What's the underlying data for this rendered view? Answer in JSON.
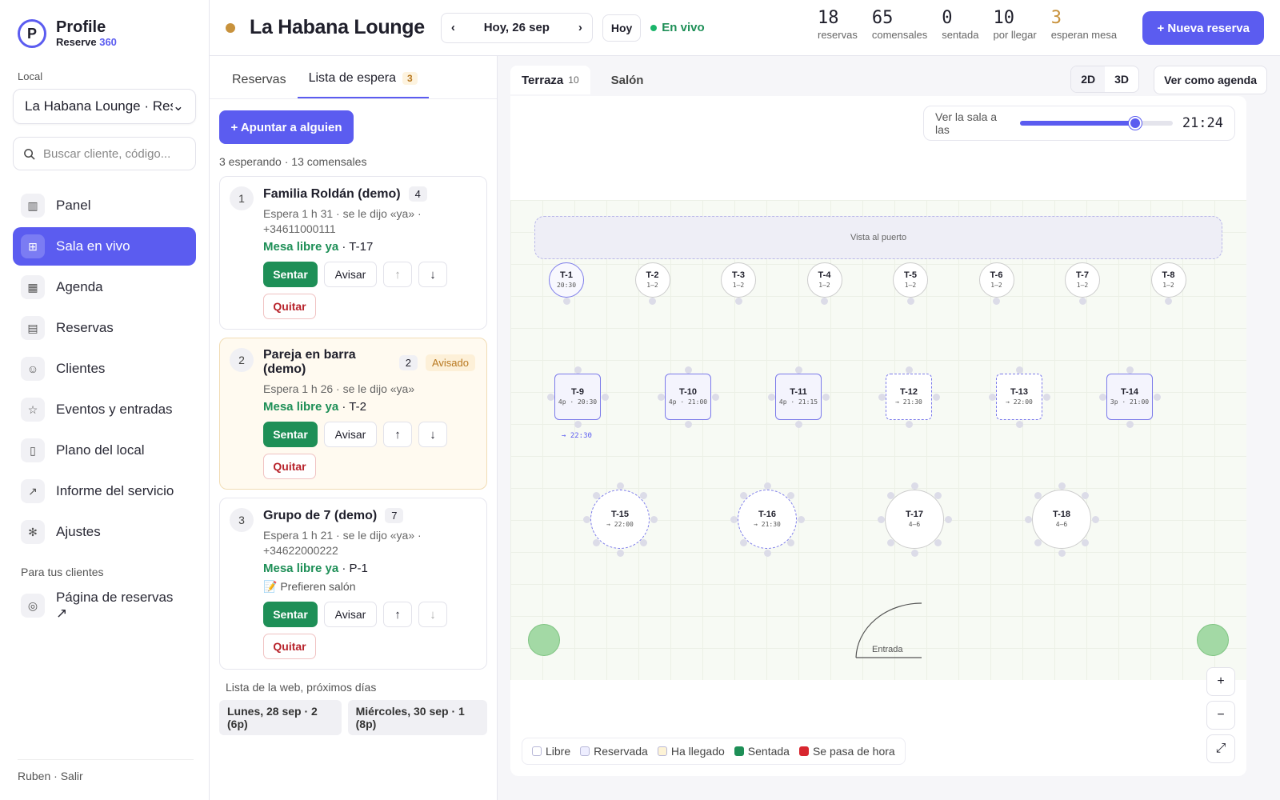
{
  "brand": {
    "title": "Profile",
    "sub_pre": "Reserve ",
    "sub_acc": "360"
  },
  "sidebar": {
    "local_label": "Local",
    "local_value": "La Habana Lounge · Res",
    "search_placeholder": "Buscar cliente, código...",
    "items": [
      {
        "label": "Panel",
        "icon": "chart"
      },
      {
        "label": "Sala en vivo",
        "icon": "grid"
      },
      {
        "label": "Agenda",
        "icon": "table"
      },
      {
        "label": "Reservas",
        "icon": "calendar"
      },
      {
        "label": "Clientes",
        "icon": "users"
      },
      {
        "label": "Eventos y entradas",
        "icon": "star"
      },
      {
        "label": "Plano del local",
        "icon": "map"
      },
      {
        "label": "Informe del servicio",
        "icon": "trend"
      },
      {
        "label": "Ajustes",
        "icon": "gear"
      }
    ],
    "section": "Para tus clientes",
    "public_page": "Página de reservas ↗",
    "footer": "Ruben · Salir"
  },
  "topbar": {
    "venue": "La Habana Lounge",
    "date": "Hoy, 26 sep",
    "today": "Hoy",
    "live": "En vivo",
    "stats": [
      {
        "n": "18",
        "l": "reservas"
      },
      {
        "n": "65",
        "l": "comensales"
      },
      {
        "n": "0",
        "l": "sentada"
      },
      {
        "n": "10",
        "l": "por llegar"
      },
      {
        "n": "3",
        "l": "esperan mesa"
      }
    ],
    "new_button": "+ Nueva reserva"
  },
  "waitlist": {
    "tab_reservas": "Reservas",
    "tab_lista": "Lista de espera",
    "tab_badge": "3",
    "add_button": "+ Apuntar a alguien",
    "summary": "3 esperando · 13 comensales",
    "cards": [
      {
        "num": "1",
        "name": "Familia Roldán (demo)",
        "count": "4",
        "tag": "",
        "meta": "Espera 1 h 31 · se le dijo «ya» · +34611000111",
        "free_label": "Mesa libre ya",
        "free_table": " · T-17",
        "note": ""
      },
      {
        "num": "2",
        "name": "Pareja en barra (demo)",
        "count": "2",
        "tag": "Avisado",
        "meta": "Espera 1 h 26 · se le dijo «ya»",
        "free_label": "Mesa libre ya",
        "free_table": " · T-2",
        "note": ""
      },
      {
        "num": "3",
        "name": "Grupo de 7 (demo)",
        "count": "7",
        "tag": "",
        "meta": "Espera 1 h 21 · se le dijo «ya» · +34622000222",
        "free_label": "Mesa libre ya",
        "free_table": " · P-1",
        "note": "📝 Prefieren salón"
      }
    ],
    "seat": "Sentar",
    "notify": "Avisar",
    "remove": "Quitar",
    "web_title": "Lista de la web, próximos días",
    "web_chips": [
      "Lunes, 28 sep · 2 (6p)",
      "Miércoles, 30 sep · 1 (8p)"
    ]
  },
  "floor": {
    "tab_terraza": "Terraza",
    "tab_terraza_count": "10",
    "tab_salon": "Salón",
    "view2d": "2D",
    "view3d": "3D",
    "agenda": "Ver como agenda",
    "time_label": "Ver la sala a las",
    "time": "21:24",
    "time_progress": 0.72,
    "view_label": "Vista al puerto",
    "entry_label": "Entrada",
    "under_t9": "→ 22:30",
    "tables": [
      {
        "id": "T-1",
        "sub": "20:30"
      },
      {
        "id": "T-2",
        "sub": "1–2"
      },
      {
        "id": "T-3",
        "sub": "1–2"
      },
      {
        "id": "T-4",
        "sub": "1–2"
      },
      {
        "id": "T-5",
        "sub": "1–2"
      },
      {
        "id": "T-6",
        "sub": "1–2"
      },
      {
        "id": "T-7",
        "sub": "1–2"
      },
      {
        "id": "T-8",
        "sub": "1–2"
      },
      {
        "id": "T-9",
        "sub": "4p · 20:30"
      },
      {
        "id": "T-10",
        "sub": "4p · 21:00"
      },
      {
        "id": "T-11",
        "sub": "4p · 21:15"
      },
      {
        "id": "T-12",
        "sub": "→ 21:30"
      },
      {
        "id": "T-13",
        "sub": "→ 22:00"
      },
      {
        "id": "T-14",
        "sub": "3p · 21:00"
      },
      {
        "id": "T-15",
        "sub": "→ 22:00"
      },
      {
        "id": "T-16",
        "sub": "→ 21:30"
      },
      {
        "id": "T-17",
        "sub": "4–6"
      },
      {
        "id": "T-18",
        "sub": "4–6"
      }
    ],
    "zoom_in": "+",
    "zoom_out": "−",
    "fit": "⤢",
    "legend": [
      {
        "label": "Libre",
        "color": "#ffffff"
      },
      {
        "label": "Reservada",
        "color": "#eeeeff"
      },
      {
        "label": "Ha llegado",
        "color": "#fdf3d6"
      },
      {
        "label": "Sentada",
        "color": "#1e8f57"
      },
      {
        "label": "Se pasa de hora",
        "color": "#d8262f"
      }
    ]
  }
}
